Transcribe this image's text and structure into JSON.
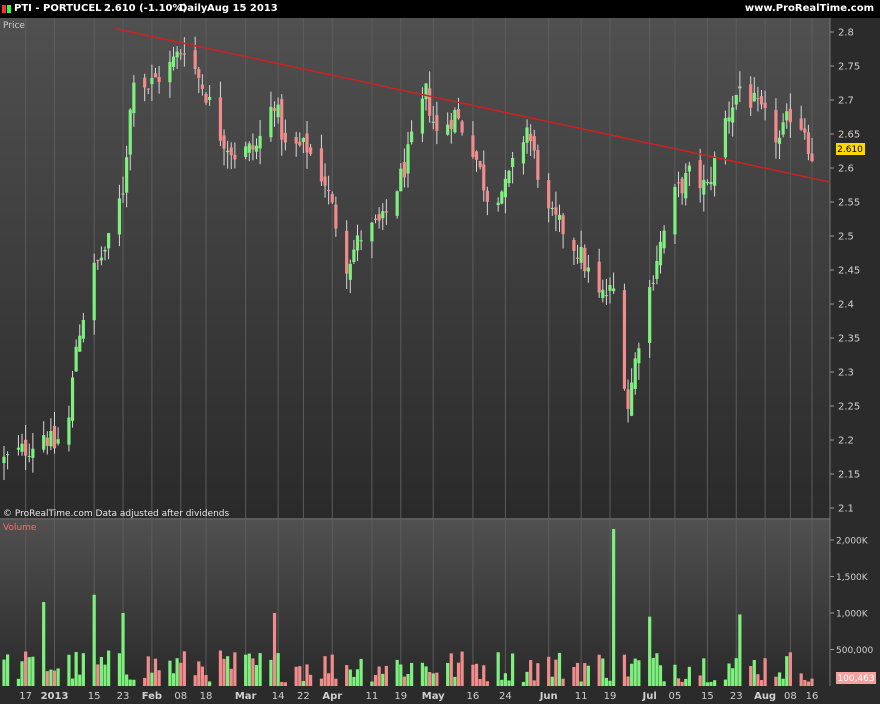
{
  "header": {
    "symbol": "PTI - PORTUCEL",
    "price": "2.610 (-1.10%)",
    "period": "Daily",
    "date": "Aug 15 2013",
    "brand": "www.ProRealTime.com"
  },
  "price_panel": {
    "label": "Price",
    "footer": "© ProRealTime.com  Data adjusted after dividends",
    "last_price_label": "2.610"
  },
  "volume_panel": {
    "label": "Volume",
    "last_volume_label": "100,463"
  },
  "colors": {
    "up": "#7ef07e",
    "down": "#f08c8c",
    "trendline": "#cc2222",
    "background_top": "#505050",
    "background_bottom": "#2a2a2a",
    "price_box": "#ffd800",
    "volume_box": "#f7a0a0",
    "volume_label": "#ff6a6a"
  },
  "chart_data": [
    {
      "type": "candlestick",
      "ylim": [
        2.09,
        2.83
      ],
      "y_ticks": [
        "2.8",
        "2.75",
        "2.7",
        "2.65",
        "2.6",
        "2.55",
        "2.5",
        "2.45",
        "2.4",
        "2.35",
        "2.3",
        "2.25",
        "2.2",
        "2.15",
        "2.1"
      ],
      "x_tick_labels": [
        "17",
        "2013",
        "15",
        "23",
        "Feb",
        "08",
        "18",
        "Mar",
        "14",
        "22",
        "Apr",
        "11",
        "19",
        "May",
        "16",
        "24",
        "Jun",
        "11",
        "19",
        "Jul",
        "05",
        "15",
        "23",
        "Aug",
        "08",
        "16"
      ],
      "x_range": [
        "2013-01-03",
        "2013-08-15"
      ],
      "trendline": {
        "start": {
          "date": "2013-01-03",
          "value": 2.84
        },
        "end": {
          "date": "2013-08-15",
          "value": 2.585
        }
      },
      "last_value": 2.61,
      "anchors": [
        [
          "2013-01-03",
          2.17
        ],
        [
          "2013-01-10",
          2.19
        ],
        [
          "2013-01-14",
          2.21
        ],
        [
          "2013-01-17",
          2.19
        ],
        [
          "2013-01-21",
          2.23
        ],
        [
          "2013-01-23",
          2.34
        ],
        [
          "2013-01-28",
          2.45
        ],
        [
          "2013-02-01",
          2.49
        ],
        [
          "2013-02-05",
          2.57
        ],
        [
          "2013-02-08",
          2.74
        ],
        [
          "2013-02-12",
          2.72
        ],
        [
          "2013-02-18",
          2.75
        ],
        [
          "2013-02-22",
          2.78
        ],
        [
          "2013-02-28",
          2.71
        ],
        [
          "2013-03-04",
          2.65
        ],
        [
          "2013-03-08",
          2.62
        ],
        [
          "2013-03-14",
          2.63
        ],
        [
          "2013-03-19",
          2.7
        ],
        [
          "2013-03-22",
          2.63
        ],
        [
          "2013-03-28",
          2.63
        ],
        [
          "2013-04-02",
          2.58
        ],
        [
          "2013-04-08",
          2.46
        ],
        [
          "2013-04-12",
          2.5
        ],
        [
          "2013-04-18",
          2.52
        ],
        [
          "2013-04-24",
          2.6
        ],
        [
          "2013-04-30",
          2.71
        ],
        [
          "2013-05-03",
          2.65
        ],
        [
          "2013-05-08",
          2.68
        ],
        [
          "2013-05-13",
          2.63
        ],
        [
          "2013-05-17",
          2.56
        ],
        [
          "2013-05-22",
          2.57
        ],
        [
          "2013-05-28",
          2.66
        ],
        [
          "2013-06-03",
          2.53
        ],
        [
          "2013-06-07",
          2.51
        ],
        [
          "2013-06-12",
          2.47
        ],
        [
          "2013-06-17",
          2.41
        ],
        [
          "2013-06-21",
          2.42
        ],
        [
          "2013-06-25",
          2.25
        ],
        [
          "2013-06-28",
          2.35
        ],
        [
          "2013-07-03",
          2.47
        ],
        [
          "2013-07-08",
          2.56
        ],
        [
          "2013-07-12",
          2.59
        ],
        [
          "2013-07-17",
          2.57
        ],
        [
          "2013-07-22",
          2.67
        ],
        [
          "2013-07-26",
          2.72
        ],
        [
          "2013-08-01",
          2.68
        ],
        [
          "2013-08-06",
          2.64
        ],
        [
          "2013-08-09",
          2.68
        ],
        [
          "2013-08-13",
          2.66
        ],
        [
          "2013-08-15",
          2.61
        ]
      ]
    },
    {
      "type": "bar",
      "ylim": [
        0,
        2200
      ],
      "y_ticks": [
        "2,000K",
        "1,500K",
        "1,000K",
        "500,000"
      ],
      "units": "K",
      "spikes": [
        [
          "2013-01-14",
          1150
        ],
        [
          "2013-01-28",
          1250
        ],
        [
          "2013-02-05",
          1000
        ],
        [
          "2013-03-19",
          1000
        ],
        [
          "2013-06-21",
          2150
        ],
        [
          "2013-07-01",
          950
        ],
        [
          "2013-07-26",
          980
        ]
      ],
      "typical_range": [
        50,
        500
      ],
      "last_value": 100.463
    }
  ]
}
